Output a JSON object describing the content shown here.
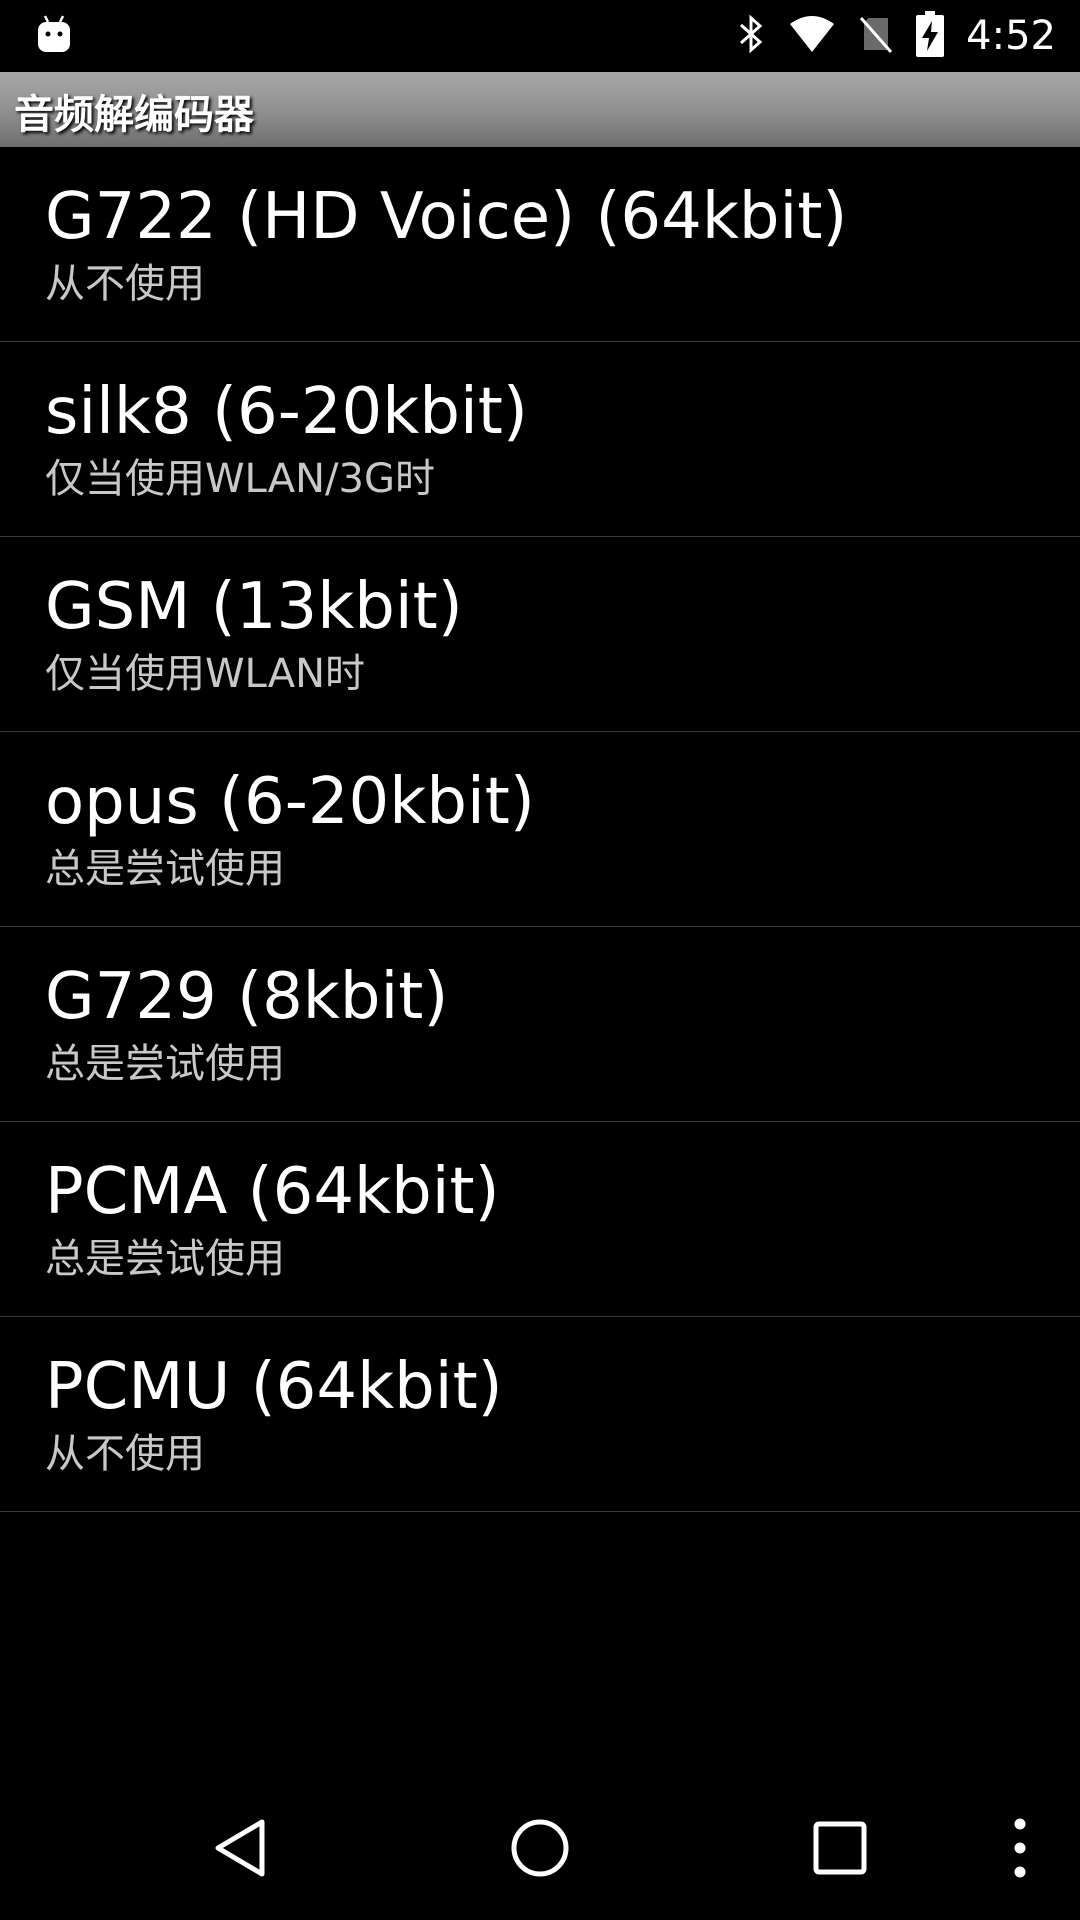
{
  "status_bar": {
    "time": "4:52",
    "icons": [
      "android-debug-icon",
      "bluetooth-icon",
      "wifi-icon",
      "no-sim-icon",
      "battery-charging-icon"
    ]
  },
  "header": {
    "title": "音频解编码器"
  },
  "codecs": [
    {
      "name": "G722 (HD Voice) (64kbit)",
      "mode": "从不使用"
    },
    {
      "name": "silk8 (6-20kbit)",
      "mode": "仅当使用WLAN/3G时"
    },
    {
      "name": "GSM (13kbit)",
      "mode": "仅当使用WLAN时"
    },
    {
      "name": "opus (6-20kbit)",
      "mode": "总是尝试使用"
    },
    {
      "name": "G729 (8kbit)",
      "mode": "总是尝试使用"
    },
    {
      "name": "PCMA (64kbit)",
      "mode": "总是尝试使用"
    },
    {
      "name": "PCMU (64kbit)",
      "mode": "从不使用"
    }
  ],
  "nav_bar": {
    "buttons": [
      "back-icon",
      "home-icon",
      "recents-icon",
      "overflow-menu-icon"
    ]
  },
  "colors": {
    "background": "#000000",
    "title_bar_gradient_top": "#a8a8a8",
    "title_bar_gradient_bottom": "#6e6e6e",
    "primary_text": "#ffffff",
    "secondary_text": "#c8c8c8",
    "divider": "#3a3a3a"
  }
}
